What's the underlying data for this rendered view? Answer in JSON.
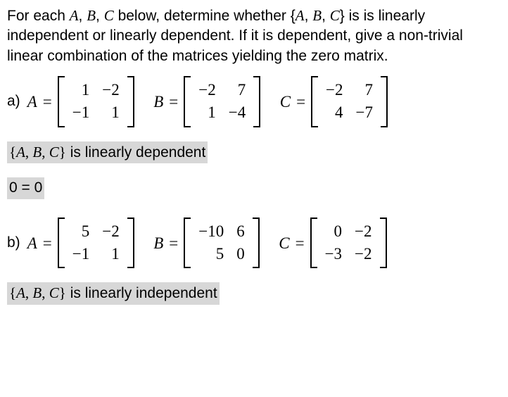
{
  "intro": {
    "t1": "For each ",
    "A": "A",
    "c1": ", ",
    "B": "B",
    "c2": ", ",
    "C": "C",
    "t2": " below, determine whether {",
    "A2": "A",
    "c3": ", ",
    "B2": "B",
    "c4": ", ",
    "C2": "C",
    "t3": "} is is linearly independent or linearly dependent. If it is dependent, give a non-trivial linear combination of the matrices yielding the zero matrix."
  },
  "parts": {
    "a": {
      "label": "a) ",
      "A": {
        "name": "A",
        "m": [
          [
            "1",
            "−2"
          ],
          [
            "−1",
            "1"
          ]
        ]
      },
      "B": {
        "name": "B",
        "m": [
          [
            "−2",
            "7"
          ],
          [
            "1",
            "−4"
          ]
        ]
      },
      "C": {
        "name": "C",
        "m": [
          [
            "−2",
            "7"
          ],
          [
            "4",
            "−7"
          ]
        ]
      },
      "answer_prefix": "{A, B, C}",
      "answer_text": " is linearly dependent",
      "combo": "0 = 0"
    },
    "b": {
      "label": "b) ",
      "A": {
        "name": "A",
        "m": [
          [
            "5",
            "−2"
          ],
          [
            "−1",
            "1"
          ]
        ]
      },
      "B": {
        "name": "B",
        "m": [
          [
            "−10",
            "6"
          ],
          [
            "5",
            "0"
          ]
        ]
      },
      "C": {
        "name": "C",
        "m": [
          [
            "0",
            "−2"
          ],
          [
            "−3",
            "−2"
          ]
        ]
      },
      "answer_prefix": "{A, B, C}",
      "answer_text": " is linearly independent"
    }
  },
  "eq": " = "
}
